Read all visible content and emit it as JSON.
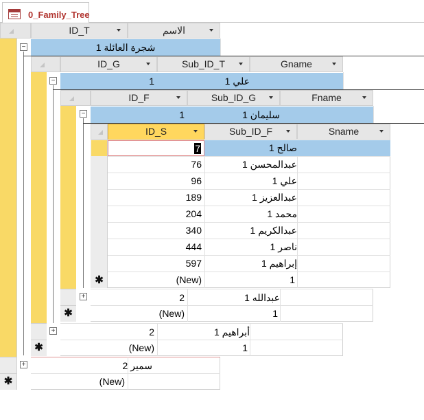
{
  "tab": {
    "label": "0_Family_Tree"
  },
  "level1": {
    "headers": [
      "ID_T",
      "الاسم"
    ],
    "rows": [
      {
        "id": "1",
        "name": "شجرة العائلة"
      },
      {
        "id": "2",
        "name": "سمير"
      }
    ],
    "new_label": "(New)"
  },
  "level2": {
    "headers": [
      "ID_G",
      "Sub_ID_T",
      "Gname"
    ],
    "rows": [
      {
        "id": "1",
        "sub": "1",
        "name": "علي"
      },
      {
        "id": "2",
        "sub": "1",
        "name": "أبراهيم"
      }
    ],
    "new_label": "(New)",
    "new_sub": "1"
  },
  "level3": {
    "headers": [
      "ID_F",
      "Sub_ID_G",
      "Fname"
    ],
    "rows": [
      {
        "id": "1",
        "sub": "1",
        "name": "سليمان"
      },
      {
        "id": "2",
        "sub": "1",
        "name": "عبدالله"
      }
    ],
    "new_label": "(New)",
    "new_sub": "1"
  },
  "level4": {
    "headers": [
      "ID_S",
      "Sub_ID_F",
      "Sname"
    ],
    "rows": [
      {
        "id": "7",
        "sub": "1",
        "name": "صالح"
      },
      {
        "id": "76",
        "sub": "1",
        "name": "عبدالمحسن"
      },
      {
        "id": "96",
        "sub": "1",
        "name": "علي"
      },
      {
        "id": "189",
        "sub": "1",
        "name": "عبدالعزيز"
      },
      {
        "id": "204",
        "sub": "1",
        "name": "محمد"
      },
      {
        "id": "340",
        "sub": "1",
        "name": "عبدالكريم"
      },
      {
        "id": "444",
        "sub": "1",
        "name": "ناصر"
      },
      {
        "id": "597",
        "sub": "1",
        "name": "إبراهيم"
      }
    ],
    "new_label": "(New)",
    "new_sub": "1"
  },
  "colors": {
    "selector_yellow": "#f9d966",
    "selected_row_blue": "#a4cbea",
    "tab_text_red": "#b1342f"
  }
}
